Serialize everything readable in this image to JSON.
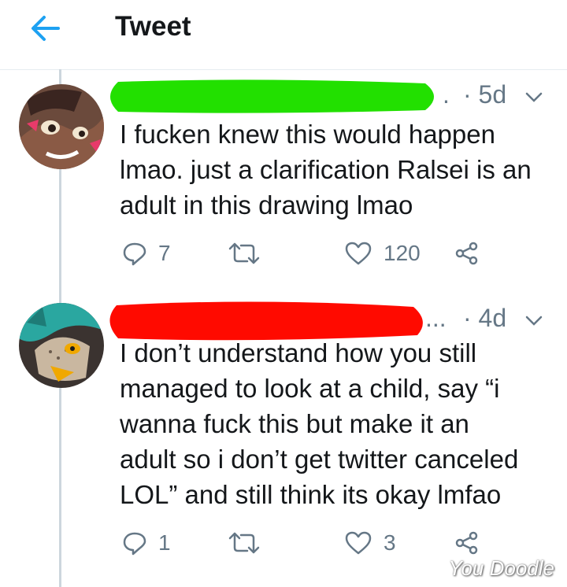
{
  "header": {
    "title": "Tweet"
  },
  "tweets": [
    {
      "redaction_color": "#22e000",
      "meta_fragment": ".",
      "time": "· 5d",
      "lines": [
        "I fucken knew this would happen",
        "lmao. just a clarification Ralsei is an",
        "adult in this drawing lmao"
      ],
      "replies": "7",
      "retweets": "",
      "likes": "120"
    },
    {
      "redaction_color": "#ff0a00",
      "meta_fragment": "...",
      "time": "· 4d",
      "lines": [
        "I don’t understand how you still",
        "managed to look at a child, say “i",
        "wanna fuck this but make it an",
        "adult so i don’t get twitter canceled",
        "LOL” and still think its okay lmfao"
      ],
      "replies": "1",
      "retweets": "",
      "likes": "3"
    }
  ],
  "watermark": "You Doodle",
  "colors": {
    "icon_gray": "#657786",
    "accent": "#1da1f2"
  }
}
